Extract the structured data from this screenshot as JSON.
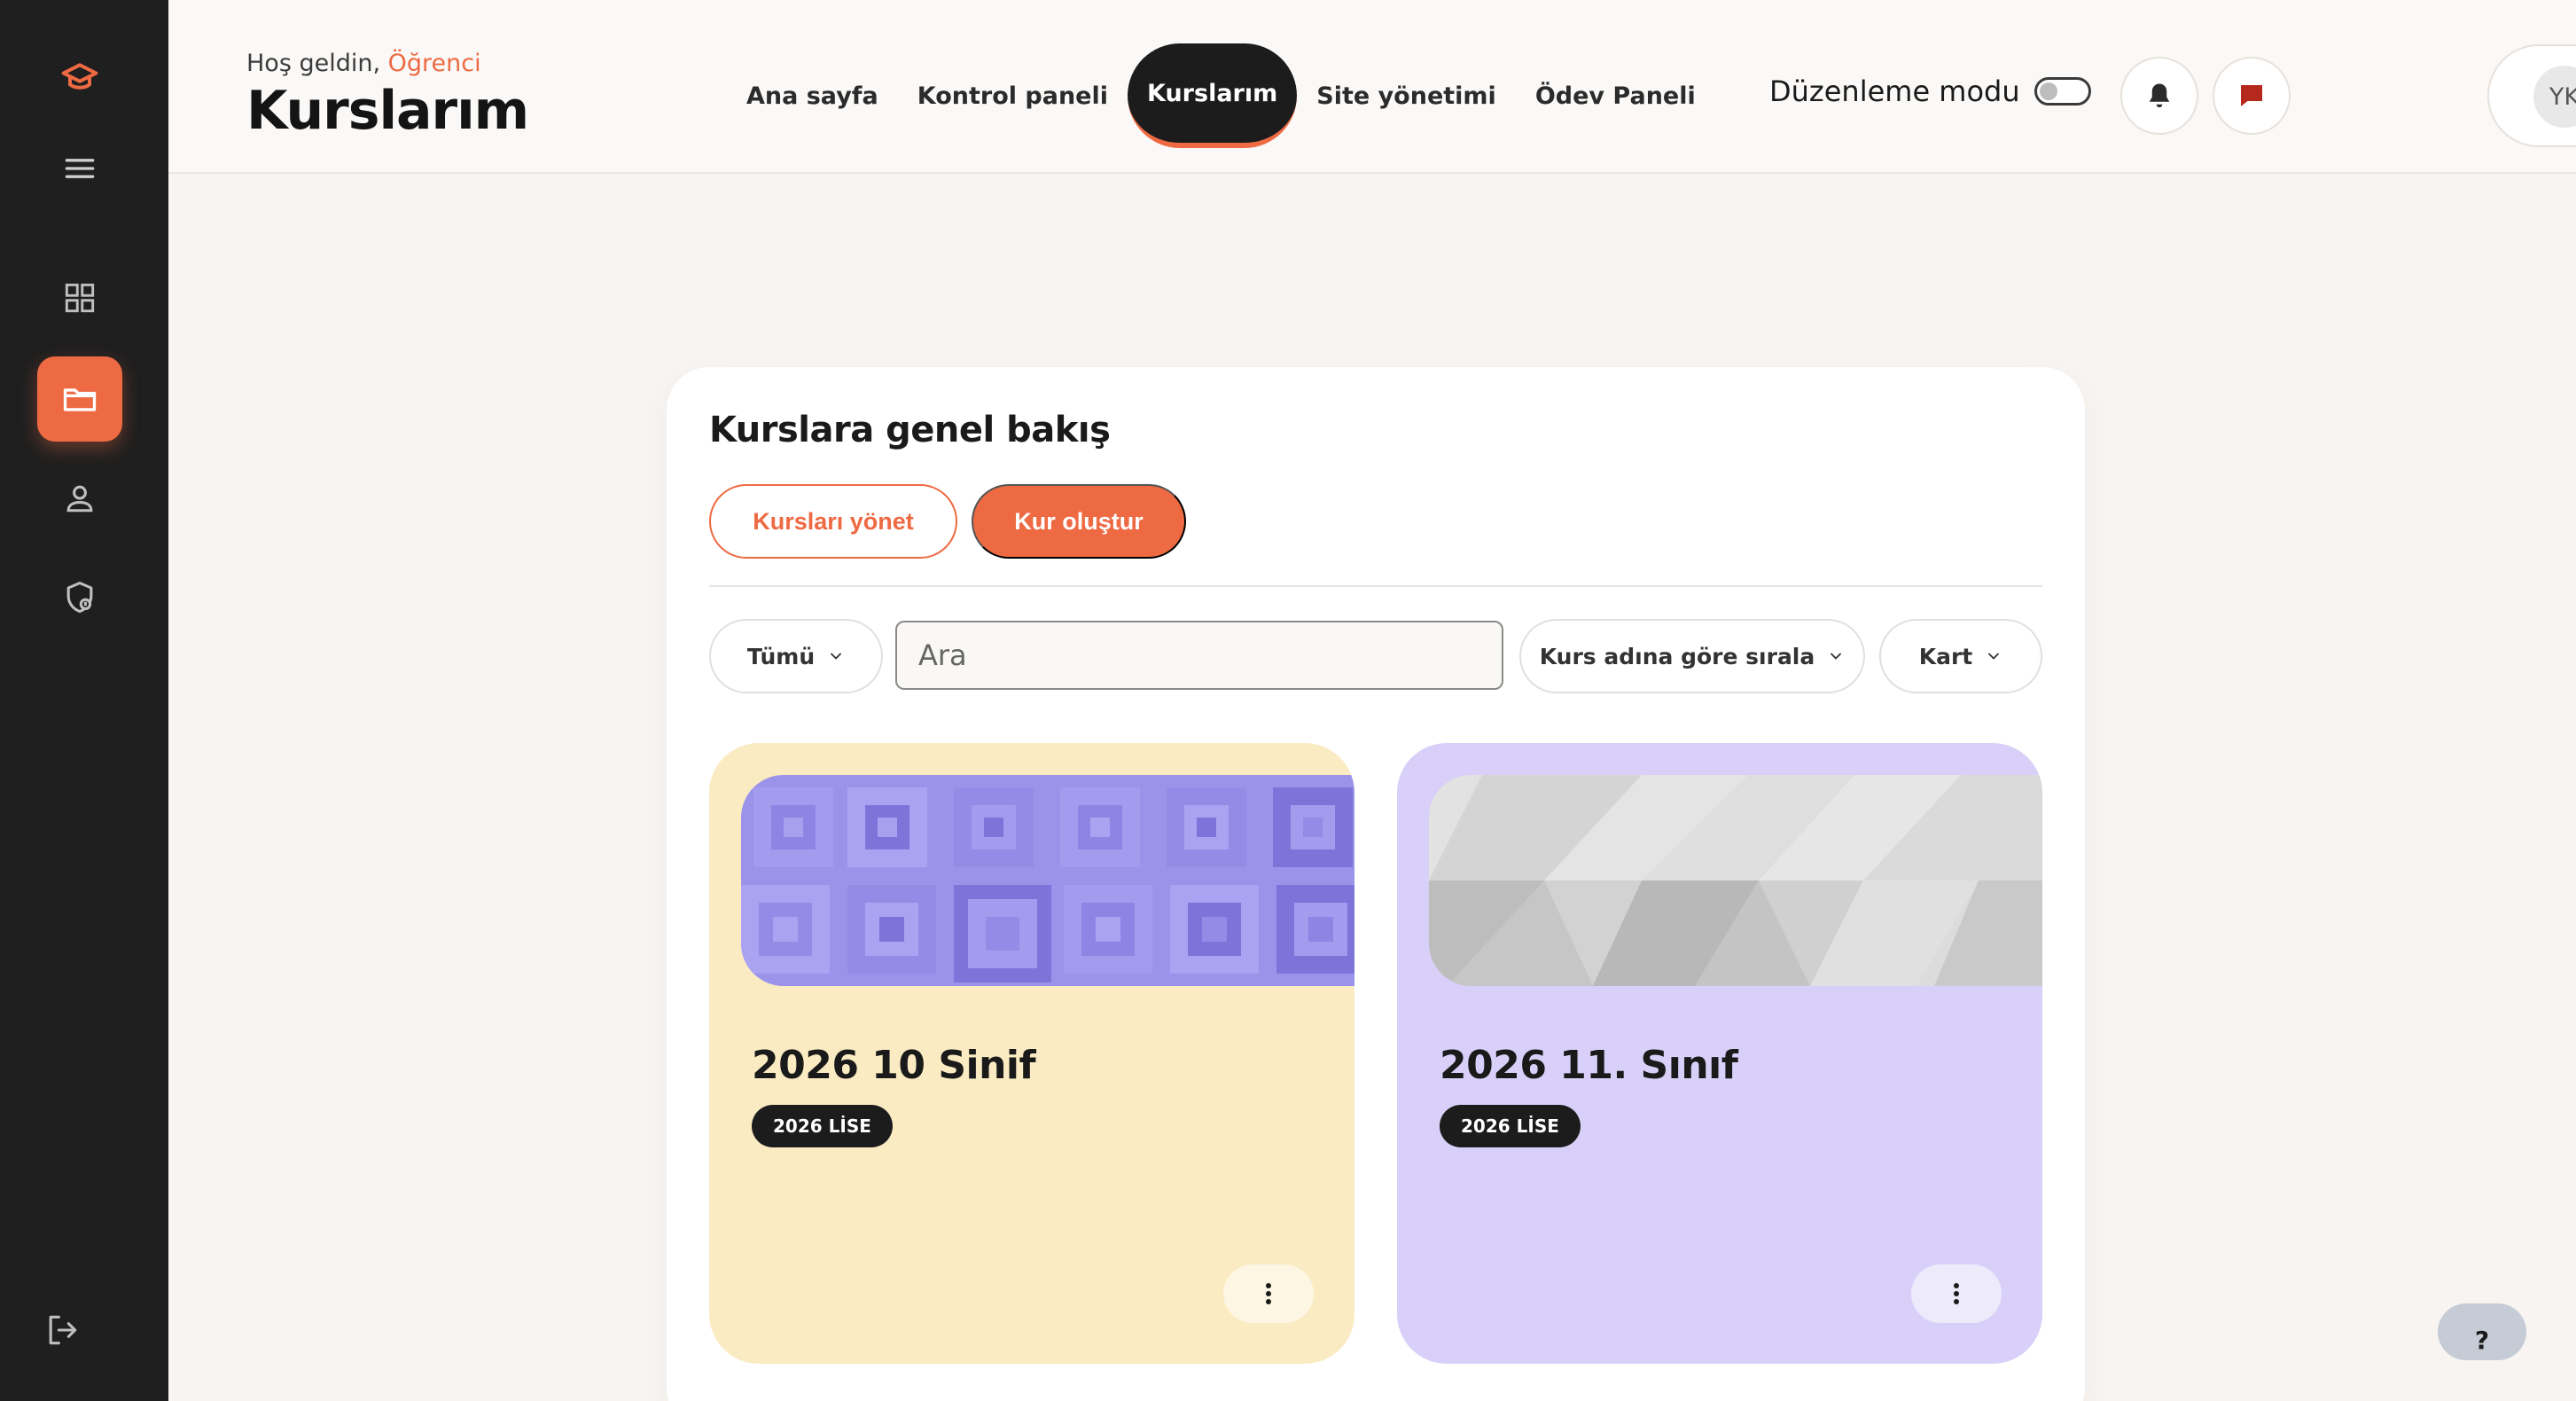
{
  "header": {
    "welcome_prefix": "Hoş geldin,",
    "welcome_role": "Öğrenci",
    "page_title": "Kurslarım",
    "nav": [
      "Ana sayfa",
      "Kontrol paneli",
      "Kurslarım",
      "Site yönetimi",
      "Ödev Paneli"
    ],
    "active_nav": "Kurslarım",
    "edit_mode_label": "Düzenleme modu",
    "edit_mode_on": false,
    "user_initials": "YK"
  },
  "sidebar": {
    "items": [
      "logo-icon",
      "menu-icon",
      "dashboard-icon",
      "folder-icon",
      "user-icon",
      "shield-icon",
      "logout-icon"
    ],
    "active": "folder-icon"
  },
  "main": {
    "section_title": "Kurslara genel bakış",
    "manage_courses_label": "Kursları yönet",
    "create_course_label": "Kur oluştur",
    "filter_label": "Tümü",
    "search_placeholder": "Ara",
    "sort_label": "Kurs adına göre sırala",
    "view_label": "Kart",
    "courses": [
      {
        "title": "2026 10 Sinif",
        "tag": "2026 LİSE",
        "bg": "#fbebc2"
      },
      {
        "title": "2026 11. Sınıf",
        "tag": "2026 LİSE",
        "bg": "#d8d0f8"
      }
    ]
  },
  "help_label": "?",
  "colors": {
    "accent": "#ee6a43",
    "sidebar": "#1f1f1f",
    "card_yellow": "#fbebc2",
    "card_purple": "#d8d0f8"
  }
}
